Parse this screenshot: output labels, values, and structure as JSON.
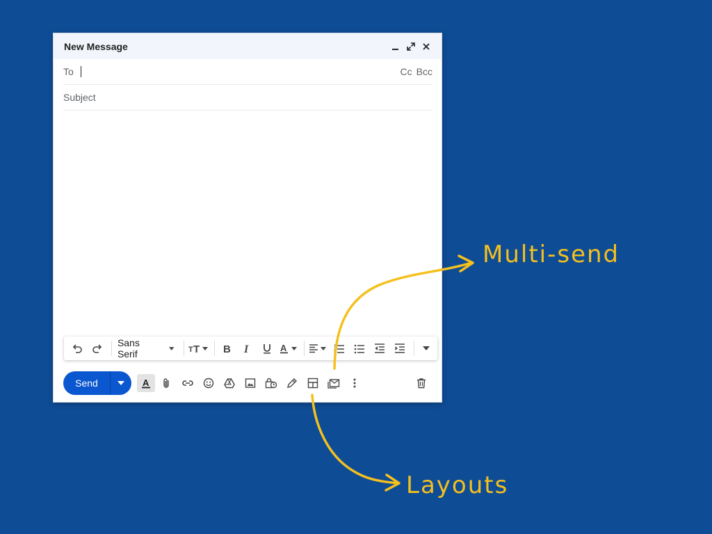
{
  "compose": {
    "title": "New Message",
    "to_label": "To",
    "to_value": "",
    "cc_label": "Cc",
    "bcc_label": "Bcc",
    "subject_placeholder": "Subject",
    "body": ""
  },
  "format_bar": {
    "font_name": "Sans Serif"
  },
  "bottom_bar": {
    "send_label": "Send"
  },
  "annotations": {
    "multi_send": "Multi-send",
    "layouts": "Layouts",
    "color": "#f4c01e"
  },
  "colors": {
    "background": "#0f4c96",
    "send_button": "#0b57d0",
    "header_bg": "#f2f6fc"
  }
}
